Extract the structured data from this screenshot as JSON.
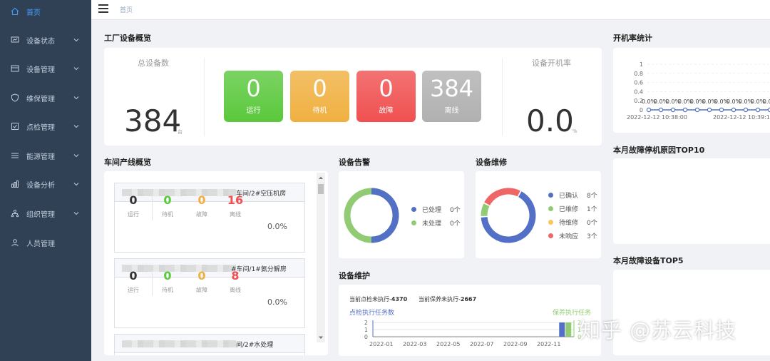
{
  "sidebar": {
    "items": [
      {
        "label": "首页",
        "icon": "home-icon"
      },
      {
        "label": "设备状态",
        "icon": "monitor-icon"
      },
      {
        "label": "设备管理",
        "icon": "device-icon"
      },
      {
        "label": "维保管理",
        "icon": "shield-icon"
      },
      {
        "label": "点检管理",
        "icon": "checklist-icon"
      },
      {
        "label": "能源管理",
        "icon": "list-icon"
      },
      {
        "label": "设备分析",
        "icon": "chart-icon"
      },
      {
        "label": "组织管理",
        "icon": "org-icon"
      },
      {
        "label": "人员管理",
        "icon": "user-icon"
      }
    ],
    "active_color": "#409eff"
  },
  "header": {
    "breadcrumb": "首页"
  },
  "overview": {
    "title": "工厂设备概览",
    "total_label": "总设备数",
    "total_value": "384",
    "total_unit": "台",
    "rate_label": "设备开机率",
    "rate_value": "0.0",
    "rate_unit": "%",
    "statuses": [
      {
        "value": "0",
        "label": "运行",
        "color": "#5ac83c"
      },
      {
        "value": "0",
        "label": "待机",
        "color": "#f0b040"
      },
      {
        "value": "0",
        "label": "故障",
        "color": "#f05050"
      },
      {
        "value": "384",
        "label": "离线",
        "color": "#b0b0b0"
      }
    ]
  },
  "workshop": {
    "title": "车间产线概览",
    "panels": [
      {
        "name": "车间/2#空压机房",
        "run": "0",
        "standby": "0",
        "fault": "0",
        "offline": "16",
        "rate": "0.0%"
      },
      {
        "name": "#车间/1#氨分解房",
        "run": "0",
        "standby": "0",
        "fault": "0",
        "offline": "8",
        "rate": "0.0%"
      },
      {
        "name": "间/2#水处理",
        "run": "",
        "standby": "",
        "fault": "",
        "offline": "",
        "rate": ""
      }
    ],
    "stat_labels": {
      "run": "运行",
      "standby": "待机",
      "fault": "故障",
      "offline": "离线"
    },
    "colors": {
      "run": "#333333",
      "standby": "#5ac83c",
      "fault": "#f0b040",
      "offline": "#f05050"
    }
  },
  "alarm": {
    "title": "设备告警",
    "legend": [
      {
        "label": "已处理",
        "count": "0个",
        "color": "#5470c6"
      },
      {
        "label": "未处理",
        "count": "0个",
        "color": "#91cc75"
      }
    ]
  },
  "repair": {
    "title": "设备维修",
    "legend": [
      {
        "label": "已确认",
        "count": "8个",
        "color": "#5470c6"
      },
      {
        "label": "已维修",
        "count": "1个",
        "color": "#91cc75"
      },
      {
        "label": "待维修",
        "count": "0个",
        "color": "#fac858"
      },
      {
        "label": "未响应",
        "count": "3个",
        "color": "#ee6666"
      }
    ]
  },
  "maintain": {
    "title": "设备维护",
    "inspect_label": "当前点检未执行-",
    "inspect_value": "4370",
    "upkeep_label": "当前保养未执行-",
    "upkeep_value": "2667",
    "left_series": "点检执行任务数",
    "right_series": "保养执行任务"
  },
  "uptime": {
    "title": "开机率统计"
  },
  "fault_reason": {
    "title": "本月故障停机原因TOP10"
  },
  "fault_device": {
    "title": "本月故障设备TOP5"
  },
  "watermark": "知乎 @苏云科技",
  "chart_data": [
    {
      "type": "pie",
      "title": "设备告警",
      "categories": [
        "已处理",
        "未处理"
      ],
      "values": [
        0,
        0
      ]
    },
    {
      "type": "pie",
      "title": "设备维修",
      "categories": [
        "已确认",
        "已维修",
        "待维修",
        "未响应"
      ],
      "values": [
        8,
        1,
        0,
        3
      ]
    },
    {
      "type": "line",
      "title": "开机率统计",
      "x": [
        "2022-12-12 10:38:00",
        "2022-12-12 10:39:10"
      ],
      "yticks": [
        "0",
        "0.2",
        "0.4",
        "0.6",
        "0.8",
        "1"
      ],
      "ylim": [
        0,
        1
      ],
      "point_label": "0.0%",
      "values": [
        0,
        0,
        0,
        0,
        0,
        0,
        0,
        0,
        0,
        0,
        0,
        0
      ]
    },
    {
      "type": "bar",
      "title": "设备维护",
      "xticks": [
        "2022-01",
        "2022-03",
        "2022-05",
        "2022-07",
        "2022-09",
        "2022-11"
      ],
      "left_yticks": [
        "0",
        "1",
        "2"
      ],
      "right_yticks": [
        "0",
        "1",
        "2"
      ],
      "series": [
        {
          "name": "点检执行任务数",
          "color": "#5470c6",
          "values": [
            {
              "x": "2022-12",
              "y": 2
            }
          ]
        },
        {
          "name": "保养执行任务",
          "color": "#91cc75",
          "values": [
            {
              "x": "2022-12",
              "y": 2
            }
          ]
        }
      ]
    }
  ]
}
